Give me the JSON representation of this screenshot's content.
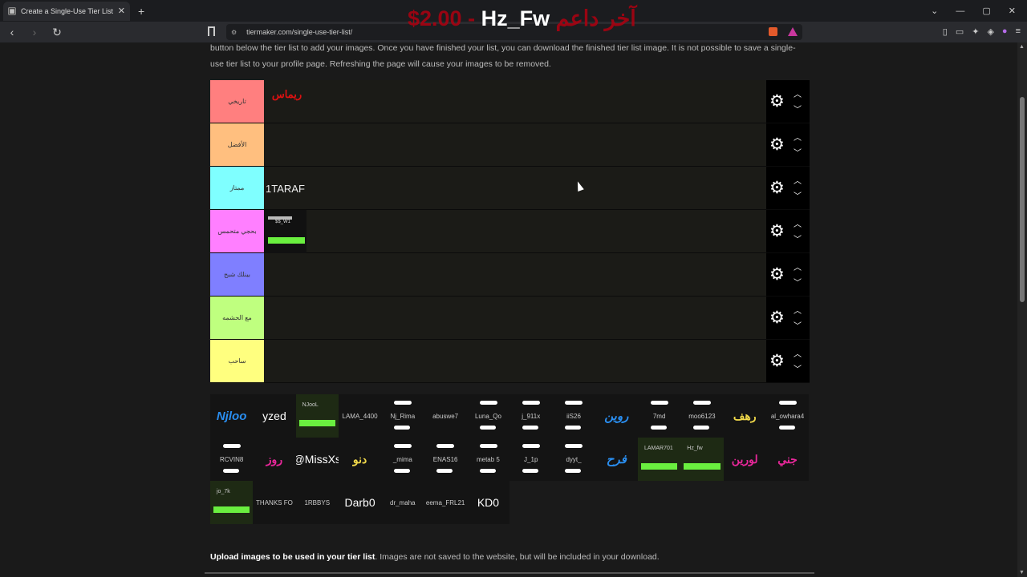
{
  "browser": {
    "tab_title": "Create a Single-Use Tier List (Pri",
    "url": "tiermaker.com/single-use-tier-list/",
    "overlay": {
      "price": "$2.00",
      "separator": " - ",
      "name": "Hz_Fw",
      "arabic": "آخر داعم"
    }
  },
  "intro_text": "button below the tier list to add your images. Once you have finished your list, you can download the finished tier list image. It is not possible to save a single-use tier list to your profile page. Refreshing the page will cause your images to be removed.",
  "tiers": [
    {
      "label": "تاريخي",
      "color": "#ff7f7f",
      "items": [
        {
          "type": "logo",
          "text": "ريماس"
        }
      ]
    },
    {
      "label": "الأفضل",
      "color": "#ffbf7f",
      "items": []
    },
    {
      "label": "ممتاز",
      "color": "#7fffff",
      "items": [
        {
          "type": "text",
          "text": "1TARAF"
        }
      ]
    },
    {
      "label": "بحجي متحمس",
      "color": "#ff7fff",
      "items": [
        {
          "type": "card",
          "text": "$$_W1"
        }
      ]
    },
    {
      "label": "بينلك شبح",
      "color": "#7f7fff",
      "items": []
    },
    {
      "label": "مع الحشمه",
      "color": "#bfff7f",
      "items": []
    },
    {
      "label": "ساحب",
      "color": "#ffff7f",
      "items": []
    }
  ],
  "pool": [
    [
      {
        "t": "Njloo",
        "c": "blue"
      },
      {
        "t": "yzed",
        "c": "white-lg"
      },
      {
        "t": "NJooL",
        "c": "green"
      },
      {
        "t": "LAMA_4400",
        "c": ""
      },
      {
        "t": "Nj_Rima",
        "c": "sc"
      },
      {
        "t": "abuswe7",
        "c": ""
      },
      {
        "t": "Luna_Qo",
        "c": "sc"
      },
      {
        "t": "j_911x",
        "c": "sc"
      },
      {
        "t": "iiS26",
        "c": "sc"
      },
      {
        "t": "روين",
        "c": "blue"
      },
      {
        "t": "7md",
        "c": "sc"
      },
      {
        "t": "moo6123",
        "c": "sc"
      },
      {
        "t": "رهف",
        "c": "yellow"
      },
      {
        "t": "al_owhara4",
        "c": "sc"
      }
    ],
    [
      {
        "t": "RCVIN8",
        "c": "sc"
      },
      {
        "t": "روز",
        "c": "pink"
      },
      {
        "t": "@MissXs",
        "c": "white-lg"
      },
      {
        "t": "دنو",
        "c": "yellow"
      },
      {
        "t": "_mima",
        "c": "sc"
      },
      {
        "t": "ENAS16",
        "c": "sc"
      },
      {
        "t": "metab 5",
        "c": "sc"
      },
      {
        "t": "J_1p",
        "c": "sc"
      },
      {
        "t": "dyyt_",
        "c": "sc"
      },
      {
        "t": "فرح",
        "c": "blue"
      },
      {
        "t": "LAMAR701",
        "c": "green"
      },
      {
        "t": "Hz_fw",
        "c": "green"
      },
      {
        "t": "لورين",
        "c": "pink"
      },
      {
        "t": "جني",
        "c": "pink"
      }
    ],
    [
      {
        "t": "jo_7k",
        "c": "green"
      },
      {
        "t": "THANKS FO",
        "c": ""
      },
      {
        "t": "1RBBYS",
        "c": ""
      },
      {
        "t": "Darb0",
        "c": "white-lg"
      },
      {
        "t": "dr_maha",
        "c": ""
      },
      {
        "t": "eema_FRL21",
        "c": ""
      },
      {
        "t": "KD0",
        "c": "white-lg"
      }
    ]
  ],
  "upload": {
    "bold": "Upload images to be used in your tier list",
    "rest": ". Images are not saved to the website, but will be included in your download."
  }
}
